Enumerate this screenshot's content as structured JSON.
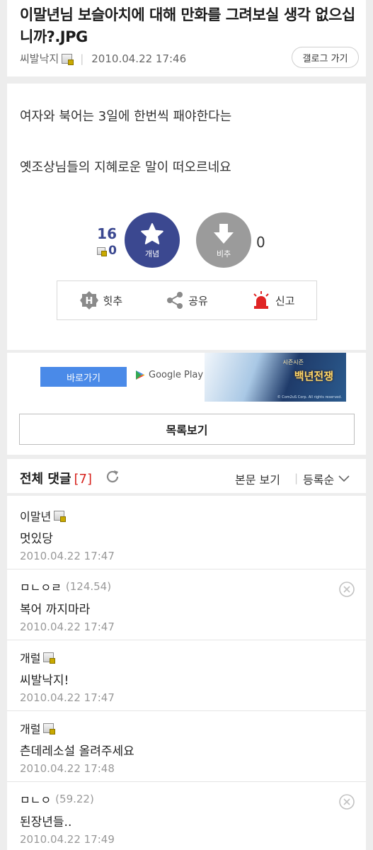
{
  "post": {
    "title": "이말년님 보슬아치에 대해 만화를 그려보실 생각 없으십니까?.JPG",
    "author": "씨발낙지",
    "date": "2010.04.22 17:46",
    "gallery_button": "갤로그 가기",
    "body_lines": [
      "여자와 북어는 3일에 한번씩 패야한다는",
      "옛조상님들의 지혜로운 말이 떠오르네요"
    ]
  },
  "votes": {
    "up_count": "16",
    "fixed_count": "0",
    "up_label": "개념",
    "down_label": "비추",
    "down_count": "0"
  },
  "actions": {
    "hit": "힛추",
    "share": "공유",
    "report": "신고"
  },
  "ad": {
    "go_label": "바로가기",
    "store_label": "Google Play",
    "game_title": "백년전쟁",
    "game_sub": "시즌시즌",
    "copyright": "© Com2uS Corp. All rights reserved."
  },
  "list_button": "목록보기",
  "comments_header": {
    "title": "전체 댓글",
    "count": "[7]",
    "view_body": "본문 보기",
    "sort": "등록순"
  },
  "comments": [
    {
      "nick": "이말년",
      "ip": "",
      "text": "멋있당",
      "date": "2010.04.22 17:47"
    },
    {
      "nick": "ㅁㄴㅇㄹ",
      "ip": "(124.54)",
      "text": "복어 까지마라",
      "date": "2010.04.22 17:47"
    },
    {
      "nick": "개럴",
      "ip": "",
      "text": "씨발낙지!",
      "date": "2010.04.22 17:47"
    },
    {
      "nick": "개럴",
      "ip": "",
      "text": "츤데레소설 올려주세요",
      "date": "2010.04.22 17:48"
    },
    {
      "nick": "ㅁㄴㅇ",
      "ip": "(59.22)",
      "text": "된장년들..",
      "date": "2010.04.22 17:49"
    }
  ],
  "colors": {
    "accent": "#3b4890",
    "count_red": "#d7241f",
    "report_red": "#e02424",
    "ad_button": "#4a8ae8"
  }
}
